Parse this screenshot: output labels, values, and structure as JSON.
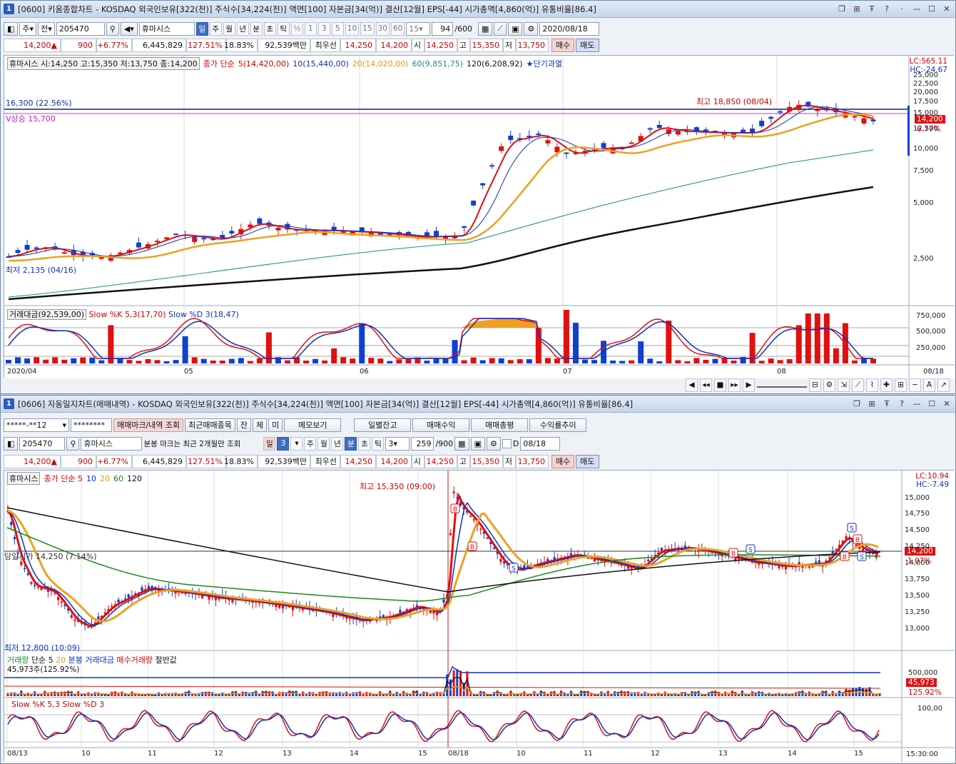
{
  "top": {
    "title": "[0600] 키움종합차트 - KOSDAQ 외국인보유[322(천)] 주식수[34,224(천)] 액면[100] 자본금[34(억)] 결산[12월] EPS[-44] 시가총액[4,860(억)] 유통비율[86.4]",
    "title_num": "1",
    "toolbar": {
      "mode1": "주",
      "mode2": "전",
      "code": "205470",
      "name": "휴마시스",
      "periods": [
        "일",
        "주",
        "월",
        "년",
        "분",
        "초",
        "틱"
      ],
      "active_period": "일",
      "half": "½",
      "nums": [
        "1",
        "3",
        "5",
        "10",
        "15",
        "30",
        "60"
      ],
      "num_sel": "15",
      "count": "94",
      "total": "/600",
      "date": "2020/08/18"
    },
    "quote": {
      "price": "14,200▲",
      "change": "900",
      "pct": "+6.77%",
      "volume": "6,445,829",
      "vol_ratio": "127.51%",
      "turnover": "18.83%",
      "amount": "92,539백만",
      "best_label": "최우선",
      "best_sell": "14,250",
      "best_buy": "14,200",
      "open_label": "시",
      "open": "14,250",
      "high_label": "고",
      "high": "15,350",
      "low_label": "저",
      "low": "13,750",
      "buy": "매수",
      "sell": "매도"
    },
    "legend": {
      "tag": "휴마시스 시:14,250 고:15,350 저:13,750 종:14,200",
      "ma_label": "종가 단순",
      "ma5": "5(14,420,00)",
      "ma10": "10(15,440,00)",
      "ma20": "20(14,020,00)",
      "ma60": "60(9,851,75)",
      "ma120": "120(6,208,92)",
      "signal": "★단기과열"
    },
    "lc": "LC:565.11",
    "hc": "HC:-24.67",
    "line1": "16,300 (22.56%)",
    "line2": "V상승 15,700",
    "max_annot": "최고 18,850 (08/04)",
    "min_annot": "최저 2,135 (04/16)",
    "price_tag": "14,200",
    "pct_tag": "6.77%",
    "y_labels": [
      "25,000",
      "22,500",
      "20,000",
      "17,500",
      "15,000",
      "12,500",
      "10,000",
      "7,500",
      "5,000",
      "2,500"
    ],
    "sub_legend": {
      "a": "거래대금(92,539,00)",
      "b": "Slow %K 5,3(17,70)",
      "c": "Slow %D 3(18,47)"
    },
    "sub_y": [
      "750,000",
      "500,000",
      "250,000"
    ],
    "x_labels": [
      "2020/04",
      "05",
      "06",
      "07",
      "08"
    ],
    "x_end": "08/18"
  },
  "bottom": {
    "title": "[0606] 자동일지차트(매매내역) - KOSDAQ 외국인보유[322(천)] 주식수[34,224(천)] 액면[100] 자본금[34(억)] 결산[12월] EPS[-44] 시가총액[4,860(억)] 유통비율[86.4]",
    "title_num": "1",
    "toolbar1": {
      "account": "*****-**12",
      "password": "********",
      "b1": "매매마크/내역 조회",
      "b2": "최근매매종목",
      "b3": "잔",
      "b4": "체",
      "b5": "미",
      "b6": "메모보기",
      "b7": "일별잔고",
      "b8": "매매수익",
      "b9": "매매총평",
      "b10": "수익률추이"
    },
    "toolbar2": {
      "code": "205470",
      "name": "휴마시스",
      "note": "분봉 마크는 최근 2개월만 조회",
      "periods": [
        "일",
        "주",
        "월",
        "년",
        "분",
        "초",
        "틱"
      ],
      "sel": "3",
      "active_period": "분",
      "tick_sel": "3",
      "count": "259",
      "total": "/900",
      "d_label": "D",
      "date": "08/18"
    },
    "quote": {
      "price": "14,200▲",
      "change": "900",
      "pct": "+6.77%",
      "volume": "6,445,829",
      "vol_ratio": "127.51%",
      "turnover": "18.83%",
      "amount": "92,539백만",
      "best_label": "최우선",
      "best_sell": "14,250",
      "best_buy": "14,200",
      "open_label": "시",
      "open": "14,250",
      "high_label": "고",
      "high": "15,350",
      "low_label": "저",
      "low": "13,750",
      "buy": "매수",
      "sell": "매도"
    },
    "legend": {
      "tag": "휴마시스",
      "ma_label": "종가 단순 5",
      "m10": "10",
      "m20": "20",
      "m60": "60",
      "m120": "120"
    },
    "lc": "LC:10.94",
    "hc": "HC:-7.49",
    "max_annot": "최고 15,350 (09:00)",
    "min_annot": "최저 12,800 (10:09)",
    "open_line": "당일시가 14,250 (7.14%)",
    "price_tag": "14,200",
    "pct_tag": "1.07%",
    "y_labels": [
      "15,000",
      "14,750",
      "14,500",
      "14,250",
      "14,000",
      "13,750",
      "13,500",
      "13,250",
      "13,000"
    ],
    "vol_legend": {
      "a": "거래량",
      "b": "단순 5",
      "c": "20",
      "d": "분봉 거래대금",
      "e": "매수거래량",
      "f": "절반값",
      "g": "45,973주(125.92%)"
    },
    "vol_y": "500,000",
    "vol_tag": "45,973",
    "vol_pct": "125.92%",
    "stoch_legend": "Slow %K 5,3  Slow %D 3",
    "stoch_y": "100,00",
    "x_labels": [
      "08/13",
      "10",
      "11",
      "12",
      "13",
      "14",
      "15",
      "08/18",
      "10",
      "11",
      "12",
      "13",
      "14",
      "15"
    ],
    "x_end": "15:30:00"
  }
}
